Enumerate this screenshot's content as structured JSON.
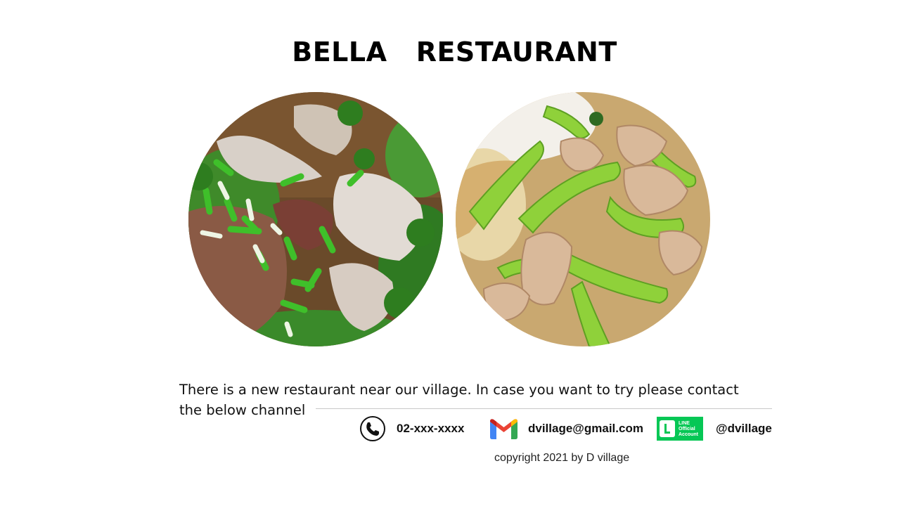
{
  "slide": {
    "title": "BELLA   RESTAURANT",
    "intro_text": "There is a new restaurant near our village. In case you want to try please contact the below channel",
    "dishes": [
      {
        "name": "soup-with-sliced-meat-and-scallions"
      },
      {
        "name": "stir-fried-pork-with-green-chili"
      }
    ],
    "contacts": {
      "phone": {
        "icon": "phone-icon",
        "value": "02-xxx-xxxx"
      },
      "email": {
        "icon": "gmail-icon",
        "value": "dvillage@gmail.com"
      },
      "line": {
        "icon": "line-official-account-icon",
        "badge_text": "LINE Official Account",
        "value": "@dvillage"
      }
    },
    "copyright": "copyright 2021 by D village"
  },
  "colors": {
    "background": "#ffffff",
    "text": "#111111",
    "line_green": "#06c755",
    "gmail_red": "#ea4335",
    "gmail_blue": "#4285f4",
    "gmail_green": "#34a853",
    "gmail_yellow": "#fbbc05",
    "divider": "#c8c8c8"
  }
}
